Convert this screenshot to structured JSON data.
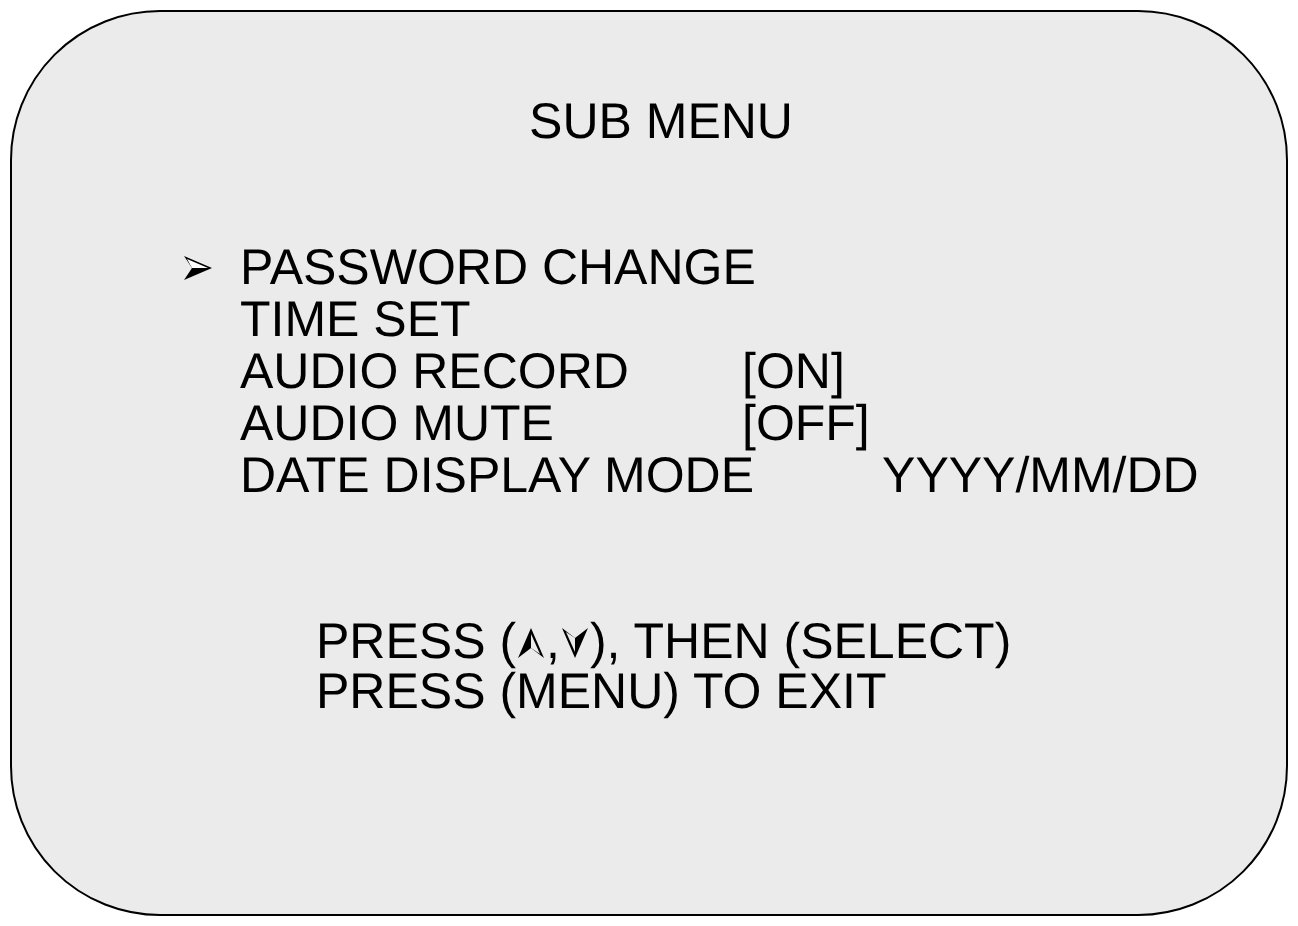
{
  "title": "SUB MENU",
  "items": [
    {
      "label": "PASSWORD CHANGE",
      "selected": true
    },
    {
      "label": "TIME SET",
      "selected": false
    },
    {
      "label": "AUDIO RECORD",
      "value": "[ON]",
      "selected": false
    },
    {
      "label": "AUDIO MUTE",
      "value": "[OFF]",
      "selected": false
    },
    {
      "label": "DATE DISPLAY MODE",
      "value": "YYYY/MM/DD",
      "kind": "wide",
      "selected": false
    }
  ],
  "hint": {
    "before": "PRESS (",
    "separator": ",",
    "after": "), THEN (SELECT)",
    "exit": "PRESS (MENU) TO EXIT"
  }
}
